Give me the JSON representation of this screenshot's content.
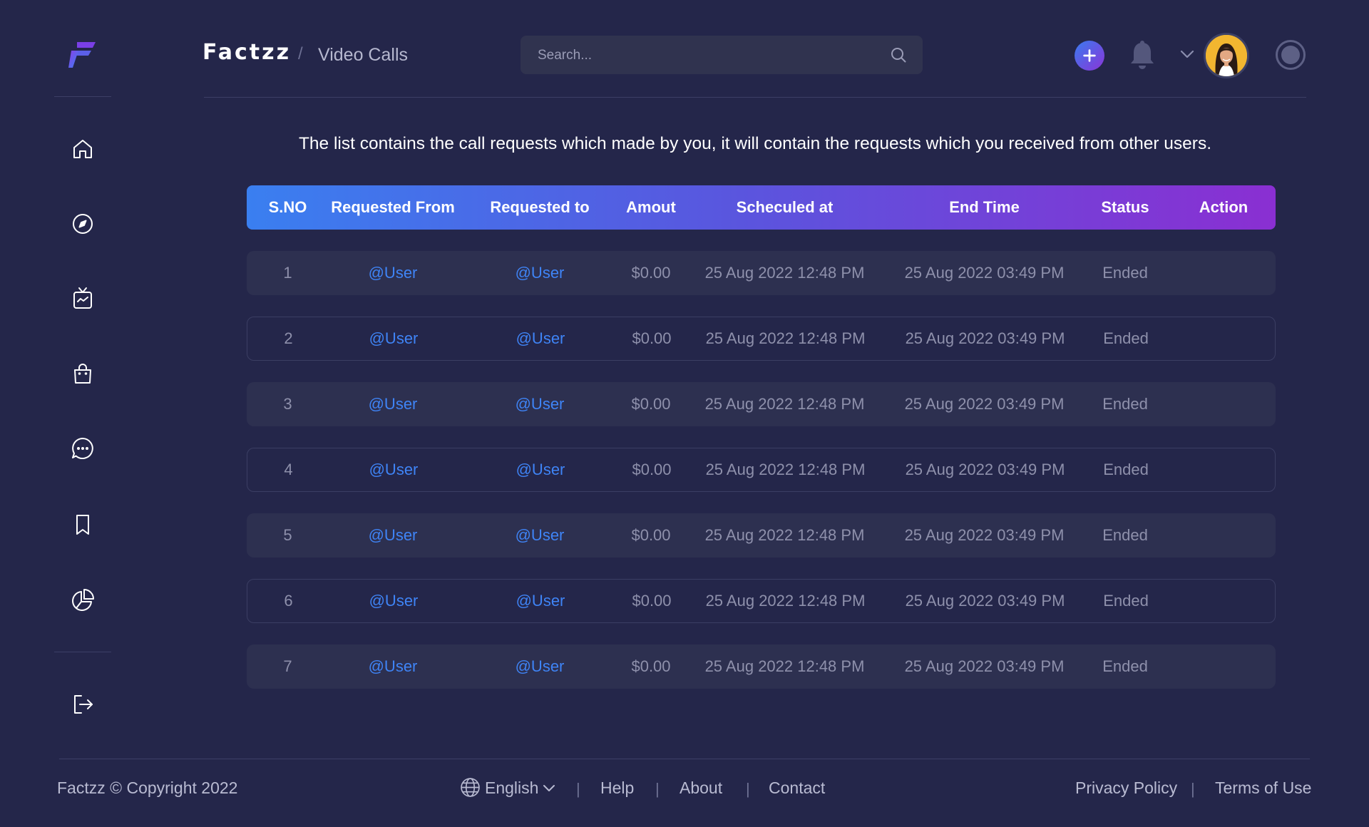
{
  "header": {
    "brand": "Factzz",
    "breadcrumb_separator": "/",
    "page_title": "Video Calls",
    "search_placeholder": "Search...",
    "avatar_alt": "User avatar"
  },
  "sidebar": {
    "items": [
      {
        "icon": "home-icon"
      },
      {
        "icon": "compass-icon"
      },
      {
        "icon": "tv-icon"
      },
      {
        "icon": "shopping-bag-icon"
      },
      {
        "icon": "chat-icon"
      },
      {
        "icon": "bookmark-icon"
      },
      {
        "icon": "pie-chart-icon"
      }
    ],
    "logout_icon": "logout-icon"
  },
  "main": {
    "intro": "The list contains the call requests which made by you, it will contain the requests which you received from other users.",
    "table": {
      "headers": [
        "S.NO",
        "Requested From",
        "Requested to",
        "Amout",
        "Scheculed at",
        "End Time",
        "Status",
        "Action"
      ],
      "rows": [
        {
          "sno": "1",
          "from": "@User",
          "to": "@User",
          "amount": "$0.00",
          "scheduled": "25 Aug 2022 12:48 PM",
          "end": "25 Aug 2022 03:49 PM",
          "status": "Ended"
        },
        {
          "sno": "2",
          "from": "@User",
          "to": "@User",
          "amount": "$0.00",
          "scheduled": "25 Aug 2022 12:48 PM",
          "end": "25 Aug 2022 03:49 PM",
          "status": "Ended"
        },
        {
          "sno": "3",
          "from": "@User",
          "to": "@User",
          "amount": "$0.00",
          "scheduled": "25 Aug 2022 12:48 PM",
          "end": "25 Aug 2022 03:49 PM",
          "status": "Ended"
        },
        {
          "sno": "4",
          "from": "@User",
          "to": "@User",
          "amount": "$0.00",
          "scheduled": "25 Aug 2022 12:48 PM",
          "end": "25 Aug 2022 03:49 PM",
          "status": "Ended"
        },
        {
          "sno": "5",
          "from": "@User",
          "to": "@User",
          "amount": "$0.00",
          "scheduled": "25 Aug 2022 12:48 PM",
          "end": "25 Aug 2022 03:49 PM",
          "status": "Ended"
        },
        {
          "sno": "6",
          "from": "@User",
          "to": "@User",
          "amount": "$0.00",
          "scheduled": "25 Aug 2022 12:48 PM",
          "end": "25 Aug 2022 03:49 PM",
          "status": "Ended"
        },
        {
          "sno": "7",
          "from": "@User",
          "to": "@User",
          "amount": "$0.00",
          "scheduled": "25 Aug 2022 12:48 PM",
          "end": "25 Aug 2022 03:49 PM",
          "status": "Ended"
        }
      ]
    }
  },
  "footer": {
    "copyright": "Factzz © Copyright 2022",
    "language": "English",
    "separator": "|",
    "links": [
      "Help",
      "About",
      "Contact"
    ],
    "legal": [
      "Privacy Policy",
      "Terms of Use"
    ]
  },
  "colors": {
    "background": "#24264a",
    "row_fill": "#2d3050",
    "link": "#3f84f6",
    "header_gradient_start": "#3a7ff0",
    "header_gradient_end": "#8a2fd2"
  }
}
